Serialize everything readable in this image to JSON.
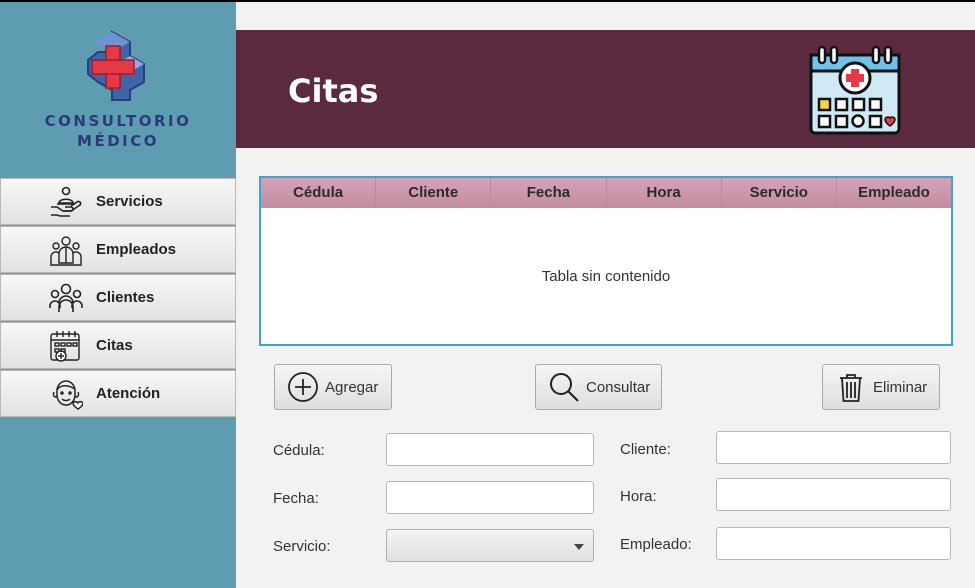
{
  "sidebar": {
    "logo_line1": "CONSULTORIO",
    "logo_line2": "MÉDICO",
    "items": [
      {
        "label": "Servicios",
        "icon": "hand-service-icon"
      },
      {
        "label": "Empleados",
        "icon": "staff-icon"
      },
      {
        "label": "Clientes",
        "icon": "clients-icon"
      },
      {
        "label": "Citas",
        "icon": "calendar-medical-icon"
      },
      {
        "label": "Atención",
        "icon": "patient-care-icon"
      }
    ]
  },
  "header": {
    "title": "Citas",
    "icon": "calendar-medical-icon"
  },
  "table": {
    "columns": [
      "Cédula",
      "Cliente",
      "Fecha",
      "Hora",
      "Servicio",
      "Empleado"
    ],
    "rows": [],
    "empty_message": "Tabla sin contenido"
  },
  "actions": {
    "add_label": "Agregar",
    "query_label": "Consultar",
    "delete_label": "Eliminar"
  },
  "form": {
    "cedula_label": "Cédula:",
    "cedula_value": "",
    "cliente_label": "Cliente:",
    "cliente_value": "",
    "fecha_label": "Fecha:",
    "fecha_value": "",
    "hora_label": "Hora:",
    "hora_value": "",
    "servicio_label": "Servicio:",
    "servicio_selected": "",
    "empleado_label": "Empleado:",
    "empleado_value": ""
  },
  "colors": {
    "sidebar": "#5e9db1",
    "header": "#5b2a3f",
    "table_header": "#c99aac",
    "table_border": "#3aa4d8",
    "logo_text": "#2a3a7a"
  }
}
